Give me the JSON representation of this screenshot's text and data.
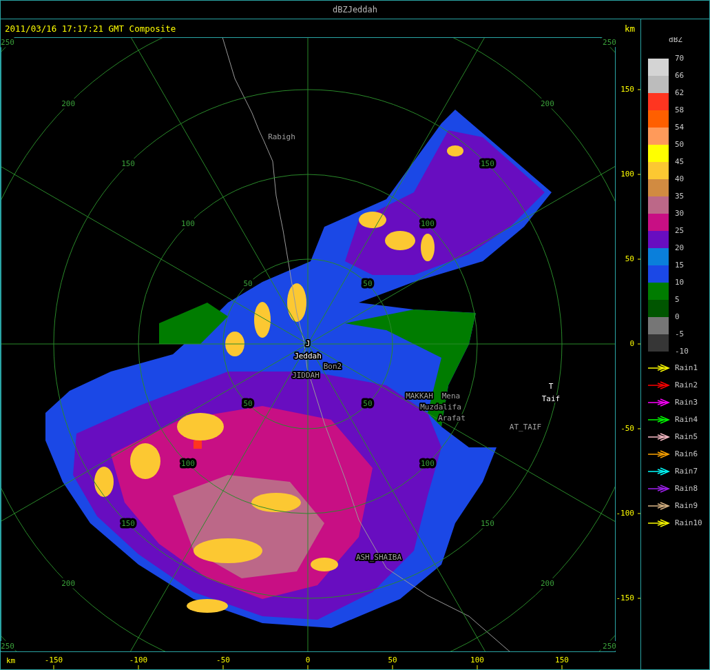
{
  "window": {
    "title": "dBZJeddah"
  },
  "header": {
    "timestamp": "2011/03/16 17:17:21 GMT Composite",
    "unit": "km"
  },
  "range_rings": [
    {
      "labels": [
        "50",
        "50",
        "50",
        "50"
      ]
    },
    {
      "labels": [
        "100",
        "100",
        "100",
        "100"
      ]
    },
    {
      "labels": [
        "150",
        "150",
        "150",
        "150"
      ]
    },
    {
      "labels": [
        "200",
        "200",
        "200",
        "200"
      ]
    },
    {
      "labels": [
        "250",
        "250",
        "250",
        "250"
      ]
    }
  ],
  "map_labels": [
    {
      "text": "Rabigh",
      "kind": "place"
    },
    {
      "text": "J",
      "kind": "radar"
    },
    {
      "text": "Jeddah",
      "kind": "radar"
    },
    {
      "text": "Bon2",
      "kind": "place"
    },
    {
      "text": "JIDDAH",
      "kind": "place"
    },
    {
      "text": "MAKKAH",
      "kind": "place"
    },
    {
      "text": "Mena",
      "kind": "place"
    },
    {
      "text": "Muzdalifa",
      "kind": "place"
    },
    {
      "text": "Arafat",
      "kind": "place"
    },
    {
      "text": "AT_TAIF",
      "kind": "place"
    },
    {
      "text": "T",
      "kind": "radar"
    },
    {
      "text": "Taif",
      "kind": "radar"
    },
    {
      "text": "ASH_SHAIBA",
      "kind": "place"
    }
  ],
  "x_axis": {
    "unit": "km",
    "ticks": [
      "-150",
      "-100",
      "-50",
      "0",
      "50",
      "100",
      "150"
    ]
  },
  "y_axis": {
    "ticks": [
      "150",
      "100",
      "50",
      "0",
      "-50",
      "-100",
      "-150"
    ]
  },
  "legend": {
    "title": "dBZ",
    "bands": [
      {
        "color": "#d4d4d4"
      },
      {
        "color": "#bcbcbc"
      },
      {
        "color": "#ff3520"
      },
      {
        "color": "#ff5f00"
      },
      {
        "color": "#ff9a5a"
      },
      {
        "color": "#ffff00"
      },
      {
        "color": "#fcc832"
      },
      {
        "color": "#d18b41"
      },
      {
        "color": "#bc6888"
      },
      {
        "color": "#c80f84"
      },
      {
        "color": "#680dc0"
      },
      {
        "color": "#0a7fdb"
      },
      {
        "color": "#1b48e6"
      },
      {
        "color": "#007c00"
      },
      {
        "color": "#005500"
      },
      {
        "color": "#767676"
      },
      {
        "color": "#363636"
      }
    ],
    "ticks": [
      "70",
      "66",
      "62",
      "58",
      "54",
      "50",
      "45",
      "40",
      "35",
      "30",
      "25",
      "20",
      "15",
      "10",
      "5",
      "0",
      "-5",
      "-10"
    ]
  },
  "tracks": [
    {
      "label": "Rain1",
      "color": "#ffff00"
    },
    {
      "label": "Rain2",
      "color": "#ff0000"
    },
    {
      "label": "Rain3",
      "color": "#ff00ff"
    },
    {
      "label": "Rain4",
      "color": "#00ff00"
    },
    {
      "label": "Rain5",
      "color": "#ffc0cb"
    },
    {
      "label": "Rain6",
      "color": "#ffa500"
    },
    {
      "label": "Rain7",
      "color": "#00ffff"
    },
    {
      "label": "Rain8",
      "color": "#a020f0"
    },
    {
      "label": "Rain9",
      "color": "#deb887"
    },
    {
      "label": "Rain10",
      "color": "#ffff00"
    }
  ]
}
